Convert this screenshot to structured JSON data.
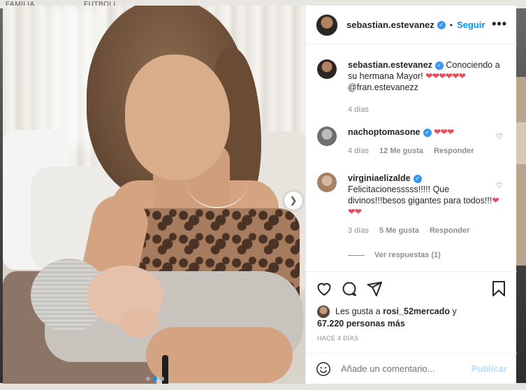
{
  "background_strip": {
    "left_label": "FAMILIA",
    "mid_label": "FUTBOLL"
  },
  "post": {
    "username": "sebastian.estevanez",
    "follow_label": "Seguir",
    "separator": "•",
    "more_icon": "more-horizontal-icon",
    "carousel": {
      "total": 3,
      "active_index": 1
    }
  },
  "caption": {
    "username": "sebastian.estevanez",
    "text": "Conociendo a su hermana Mayor!",
    "hearts": "❤❤❤❤❤❤",
    "mention": "@fran.estevanezz",
    "time": "4 días"
  },
  "comments": [
    {
      "username": "nachoptomasone",
      "text": "",
      "hearts": "❤❤❤",
      "time": "4 días",
      "likes": "12 Me gusta",
      "reply": "Responder"
    },
    {
      "username": "virginiaelizalde",
      "text": "Felicitacionesssss!!!!! Que divinos!!!besos gigantes para todos!!!",
      "hearts": "❤❤❤",
      "time": "3 días",
      "likes": "5 Me gusta",
      "reply": "Responder"
    }
  ],
  "view_replies": "Ver respuestas (1)",
  "likes": {
    "prefix": "Les gusta a ",
    "user": "rosi_52mercado",
    "mid": " y",
    "count": "67.220 personas más"
  },
  "posted_ago": "HACE 4 DÍAS",
  "add_comment": {
    "placeholder": "Añade un comentario...",
    "publish_label": "Publicar"
  },
  "colors": {
    "link": "#0095f6",
    "heart": "#ed4956",
    "publish_disabled": "#b2dffc",
    "verified": "#3897f0"
  }
}
